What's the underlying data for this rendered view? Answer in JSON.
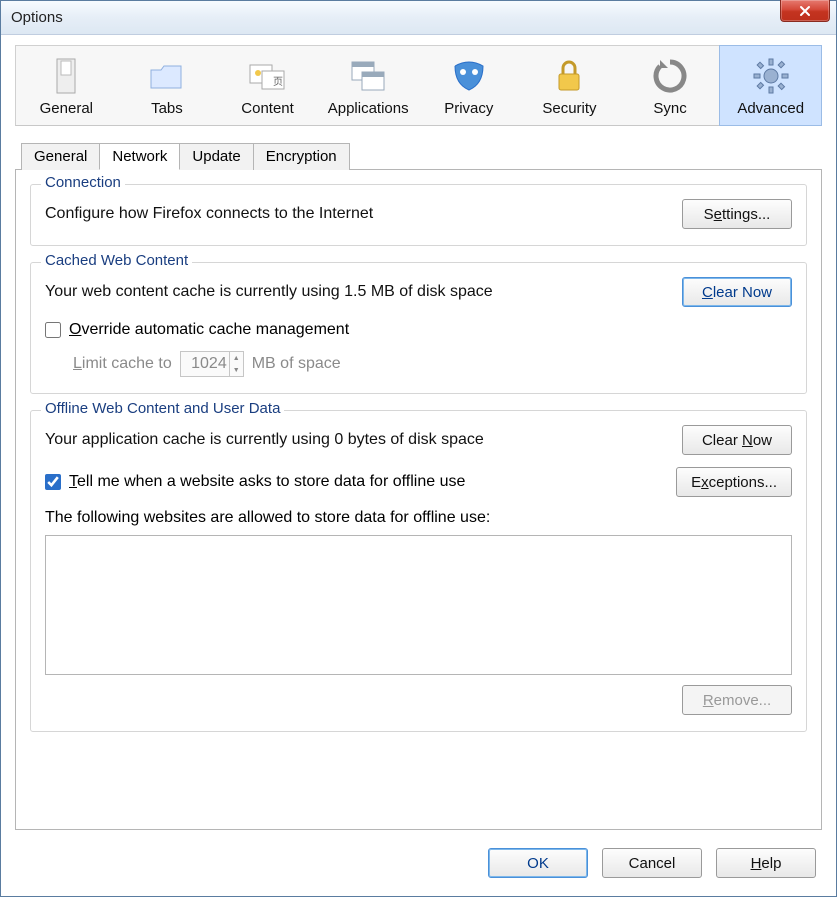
{
  "window": {
    "title": "Options"
  },
  "toolbar": {
    "items": [
      {
        "label": "General"
      },
      {
        "label": "Tabs"
      },
      {
        "label": "Content"
      },
      {
        "label": "Applications"
      },
      {
        "label": "Privacy"
      },
      {
        "label": "Security"
      },
      {
        "label": "Sync"
      },
      {
        "label": "Advanced"
      }
    ],
    "selected": "Advanced"
  },
  "subtabs": {
    "items": [
      "General",
      "Network",
      "Update",
      "Encryption"
    ],
    "active": "Network"
  },
  "connection": {
    "legend": "Connection",
    "text": "Configure how Firefox connects to the Internet",
    "settings_btn": "Settings..."
  },
  "cache": {
    "legend": "Cached Web Content",
    "status": "Your web content cache is currently using 1.5 MB of disk space",
    "clear_btn": "Clear Now",
    "override_label": "Override automatic cache management",
    "override_checked": false,
    "limit_label_pre": "Limit cache to",
    "limit_value": "1024",
    "limit_label_post": "MB of space"
  },
  "offline": {
    "legend": "Offline Web Content and User Data",
    "status": "Your application cache is currently using 0 bytes of disk space",
    "clear_btn": "Clear Now",
    "tell_label": "Tell me when a website asks to store data for offline use",
    "tell_checked": true,
    "exceptions_btn": "Exceptions...",
    "list_label": "The following websites are allowed to store data for offline use:",
    "remove_btn": "Remove..."
  },
  "footer": {
    "ok": "OK",
    "cancel": "Cancel",
    "help": "Help"
  }
}
